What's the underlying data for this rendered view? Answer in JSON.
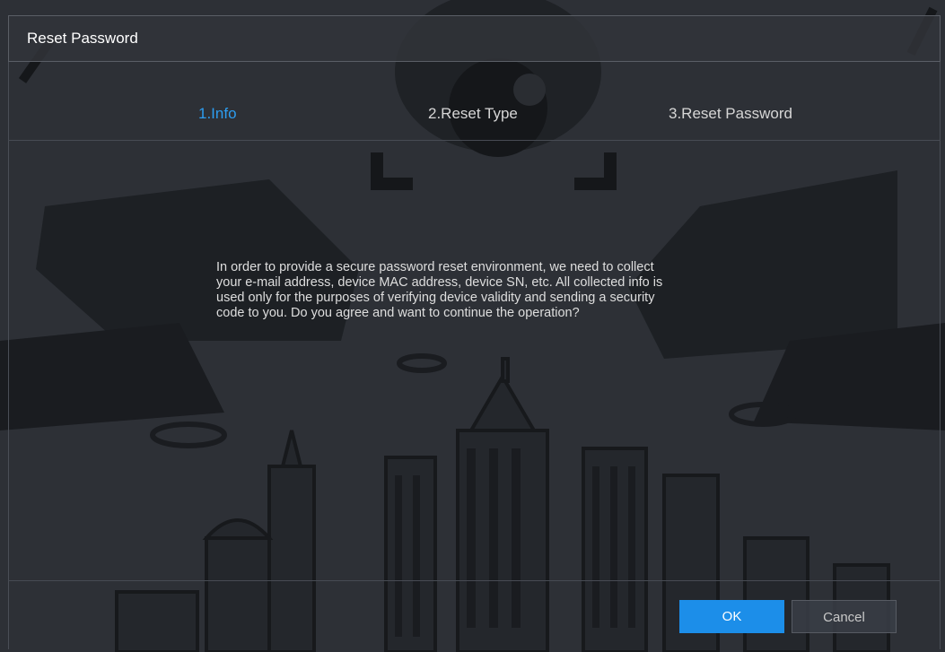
{
  "dialog": {
    "title": "Reset Password"
  },
  "steps": [
    {
      "label": "1.Info",
      "active": true
    },
    {
      "label": "2.Reset Type",
      "active": false
    },
    {
      "label": "3.Reset Password",
      "active": false
    }
  ],
  "message": {
    "line1": "In order to provide a secure password reset environment, we need to collect",
    "line2": "your e-mail address, device MAC address, device SN, etc. All collected info is",
    "line3": "used only for the purposes of verifying device validity and sending a security",
    "line4": "code to you. Do you agree and want to continue the operation?"
  },
  "buttons": {
    "ok_label": "OK",
    "cancel_label": "Cancel"
  },
  "colors": {
    "accent": "#2d9df0",
    "primary_button": "#1c8ee9",
    "background": "#2d3036"
  }
}
